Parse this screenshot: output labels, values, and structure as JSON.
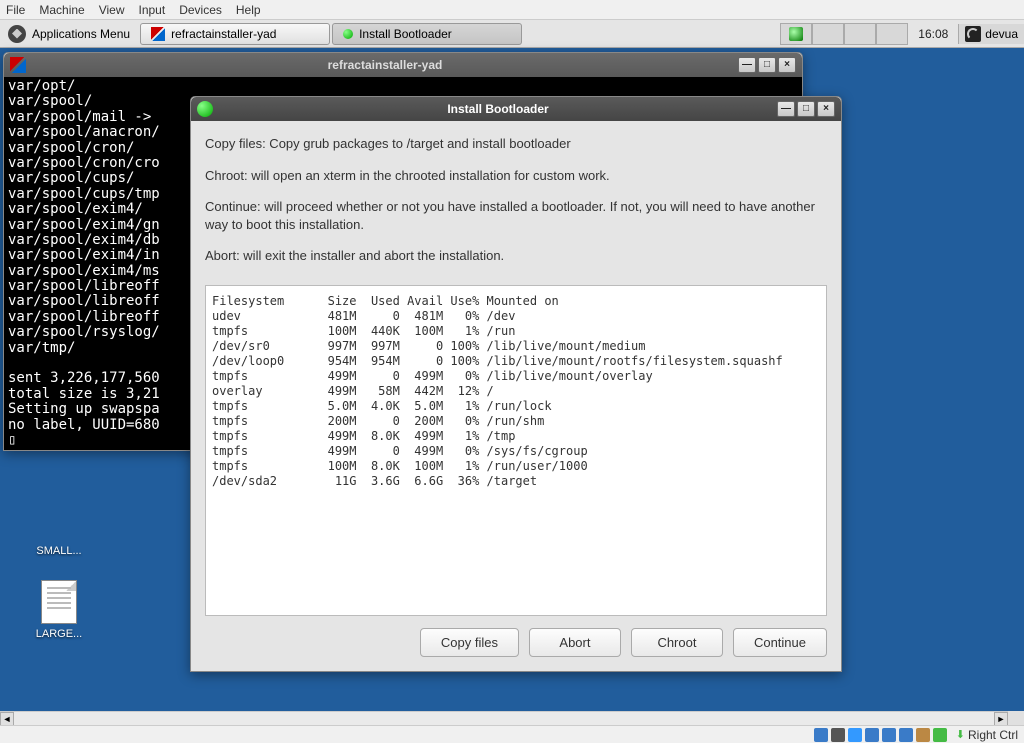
{
  "vm_menu": {
    "file": "File",
    "machine": "Machine",
    "view": "View",
    "input": "Input",
    "devices": "Devices",
    "help": "Help"
  },
  "panel": {
    "apps_label": "Applications Menu",
    "task1": "refractainstaller-yad",
    "task2": "Install Bootloader",
    "clock": "16:08",
    "user": "devua"
  },
  "desktop": {
    "icon1": "SMALL...",
    "icon2": "LARGE..."
  },
  "terminal_win": {
    "title": "refractainstaller-yad"
  },
  "terminal_text": "var/opt/\nvar/spool/\nvar/spool/mail ->\nvar/spool/anacron/\nvar/spool/cron/\nvar/spool/cron/cro\nvar/spool/cups/\nvar/spool/cups/tmp\nvar/spool/exim4/\nvar/spool/exim4/gn\nvar/spool/exim4/db\nvar/spool/exim4/in\nvar/spool/exim4/ms\nvar/spool/libreoff\nvar/spool/libreoff\nvar/spool/libreoff\nvar/spool/rsyslog/\nvar/tmp/\n\nsent 3,226,177,560\ntotal size is 3,21\nSetting up swapspa\nno label, UUID=680\n▯",
  "dialog_win": {
    "title": "Install Bootloader"
  },
  "dialog": {
    "p1": "Copy files: Copy grub packages to /target and install bootloader",
    "p2": "Chroot: will open an xterm in the chrooted installation for custom work.",
    "p3": "Continue: will proceed whether or not you have installed a bootloader. If not, you will need to have another way to boot this installation.",
    "p4": "Abort: will exit the installer and abort the installation.",
    "btn_copy": "Copy files",
    "btn_abort": "Abort",
    "btn_chroot": "Chroot",
    "btn_continue": "Continue"
  },
  "df_output": "Filesystem      Size  Used Avail Use% Mounted on\nudev            481M     0  481M   0% /dev\ntmpfs           100M  440K  100M   1% /run\n/dev/sr0        997M  997M     0 100% /lib/live/mount/medium\n/dev/loop0      954M  954M     0 100% /lib/live/mount/rootfs/filesystem.squashf\ntmpfs           499M     0  499M   0% /lib/live/mount/overlay\noverlay         499M   58M  442M  12% /\ntmpfs           5.0M  4.0K  5.0M   1% /run/lock\ntmpfs           200M     0  200M   0% /run/shm\ntmpfs           499M  8.0K  499M   1% /tmp\ntmpfs           499M     0  499M   0% /sys/fs/cgroup\ntmpfs           100M  8.0K  100M   1% /run/user/1000\n/dev/sda2        11G  3.6G  6.6G  36% /target",
  "vm_status": {
    "right_ctrl": "Right Ctrl"
  }
}
